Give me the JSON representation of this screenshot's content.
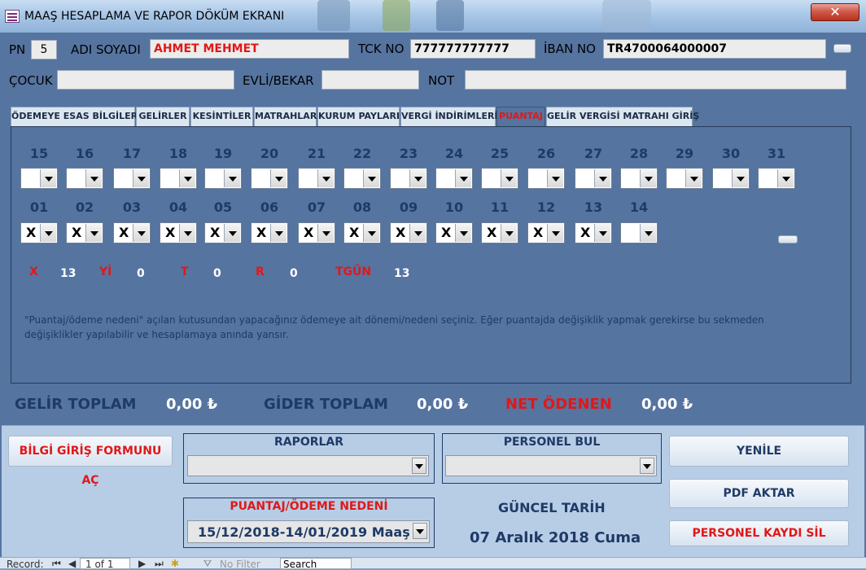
{
  "window": {
    "title": "MAAŞ HESAPLAMA VE RAPOR DÖKÜM EKRANI",
    "close": "✕"
  },
  "header": {
    "pn_label": "PN",
    "pn_value": "5",
    "name_label": "ADI SOYADI",
    "name_value": "AHMET MEHMET",
    "tck_label": "TCK NO",
    "tck_value": "777777777777",
    "iban_label": "İBAN NO",
    "iban_value": "TR4700064000007",
    "child_label": "ÇOCUK",
    "child_value": "",
    "marital_label": "EVLİ/BEKAR",
    "marital_value": "",
    "note_label": "NOT",
    "note_value": ""
  },
  "tabs": [
    {
      "label": "ÖDEMEYE ESAS BİLGİLER"
    },
    {
      "label": "GELİRLER"
    },
    {
      "label": "KESİNTİLER"
    },
    {
      "label": "MATRAHLAR"
    },
    {
      "label": "KURUM PAYLARI"
    },
    {
      "label": "VERGİ İNDİRİMLERİ"
    },
    {
      "label": "PUANTAJ"
    },
    {
      "label": "GELİR VERGİSİ MATRAHI GİRİŞ"
    }
  ],
  "active_tab": "PUANTAJ",
  "attendance": {
    "row1": [
      {
        "day": "15",
        "value": ""
      },
      {
        "day": "16",
        "value": ""
      },
      {
        "day": "17",
        "value": ""
      },
      {
        "day": "18",
        "value": ""
      },
      {
        "day": "19",
        "value": ""
      },
      {
        "day": "20",
        "value": ""
      },
      {
        "day": "21",
        "value": ""
      },
      {
        "day": "22",
        "value": ""
      },
      {
        "day": "23",
        "value": ""
      },
      {
        "day": "24",
        "value": ""
      },
      {
        "day": "25",
        "value": ""
      },
      {
        "day": "26",
        "value": ""
      },
      {
        "day": "27",
        "value": ""
      },
      {
        "day": "28",
        "value": ""
      },
      {
        "day": "29",
        "value": ""
      },
      {
        "day": "30",
        "value": ""
      },
      {
        "day": "31",
        "value": ""
      }
    ],
    "row2": [
      {
        "day": "01",
        "value": "X"
      },
      {
        "day": "02",
        "value": "X"
      },
      {
        "day": "03",
        "value": "X"
      },
      {
        "day": "04",
        "value": "X"
      },
      {
        "day": "05",
        "value": "X"
      },
      {
        "day": "06",
        "value": "X"
      },
      {
        "day": "07",
        "value": "X"
      },
      {
        "day": "08",
        "value": "X"
      },
      {
        "day": "09",
        "value": "X"
      },
      {
        "day": "10",
        "value": "X"
      },
      {
        "day": "11",
        "value": "X"
      },
      {
        "day": "12",
        "value": "X"
      },
      {
        "day": "13",
        "value": "X"
      },
      {
        "day": "14",
        "value": ""
      }
    ]
  },
  "summary": {
    "x_label": "X",
    "x_value": "13",
    "yi_label": "Yİ",
    "yi_value": "0",
    "t_label": "T",
    "t_value": "0",
    "r_label": "R",
    "r_value": "0",
    "tgun_label": "TGÜN",
    "tgun_value": "13"
  },
  "info_text": "\"Puantaj/ödeme nedeni\" açılan kutusundan yapacağınız ödemeye ait dönemi/nedeni seçiniz. Eğer puantajda değişiklik yapmak gerekirse bu sekmeden değişiklikler yapılabilir ve hesaplamaya anında yansır.",
  "totals": {
    "income_label": "GELİR TOPLAM",
    "income_value": "0,00 ₺",
    "expense_label": "GİDER TOPLAM",
    "expense_value": "0,00 ₺",
    "net_label": "NET ÖDENEN",
    "net_value": "0,00 ₺"
  },
  "bottom": {
    "info_form_button": "BİLGİ GİRİŞ FORMUNU AÇ",
    "reports_label": "RAPORLAR",
    "reports_value": "",
    "find_label": "PERSONEL BUL",
    "find_value": "",
    "period_label": "PUANTAJ/ÖDEME NEDENİ",
    "period_value": "15/12/2018-14/01/2019 Maaş",
    "date_label": "GÜNCEL TARİH",
    "date_value": "07 Aralık 2018 Cuma",
    "refresh_button": "YENİLE",
    "pdf_button": "PDF AKTAR",
    "delete_button": "PERSONEL KAYDI SİL"
  },
  "record_nav": {
    "label": "Record:",
    "position": "1 of 1",
    "filter": "No Filter",
    "search": "Search"
  },
  "colors": {
    "accent_red": "#e01818",
    "panel_blue": "#5574a0",
    "dark_blue": "#1f3a66"
  }
}
